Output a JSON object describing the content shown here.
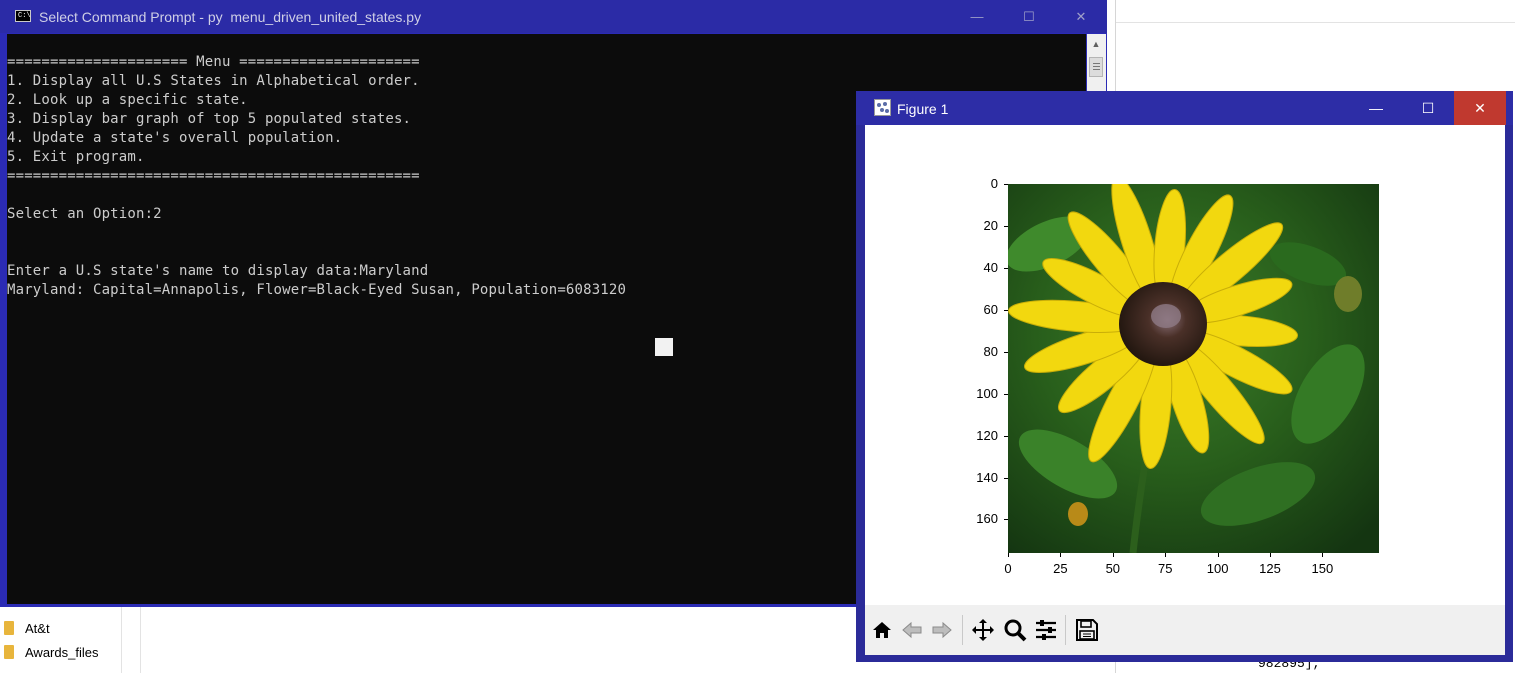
{
  "explorer": {
    "folders": [
      "At&t",
      "Awards_files"
    ],
    "code_snippet": "982895],"
  },
  "cmd": {
    "title": "Select Command Prompt - py  menu_driven_united_states.py",
    "minimize_glyph": "—",
    "maximize_glyph": "☐",
    "close_glyph": "✕",
    "lines": [
      "===================== Menu =====================",
      "1. Display all U.S States in Alphabetical order.",
      "2. Look up a specific state.",
      "3. Display bar graph of top 5 populated states.",
      "4. Update a state's overall population.",
      "5. Exit program.",
      "================================================",
      "",
      "Select an Option:2",
      "",
      "",
      "Enter a U.S state's name to display data:Maryland",
      "Maryland: Capital=Annapolis, Flower=Black-Eyed Susan, Population=6083120"
    ]
  },
  "figure": {
    "title": "Figure 1",
    "minimize_glyph": "—",
    "maximize_glyph": "☐",
    "close_glyph": "✕",
    "y_ticks": [
      "0",
      "20",
      "40",
      "60",
      "80",
      "100",
      "120",
      "140",
      "160"
    ],
    "x_ticks": [
      "0",
      "25",
      "50",
      "75",
      "100",
      "125",
      "150"
    ],
    "colors": {
      "petal": "#f2d80f",
      "center": "#3a2418",
      "leaf": "#2f6d22",
      "close_bg": "#c0392f"
    },
    "toolbar": [
      "home-icon",
      "back-icon",
      "forward-icon",
      "pan-icon",
      "zoom-icon",
      "configure-subplots-icon",
      "save-icon"
    ]
  }
}
